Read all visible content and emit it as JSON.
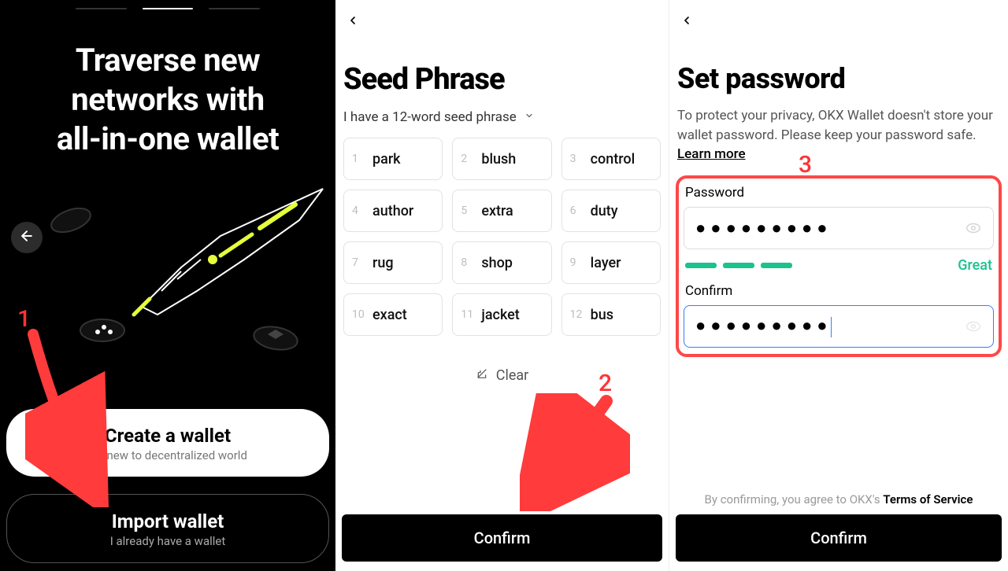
{
  "panel1": {
    "title": "Traverse new\nnetworks with\nall-in-one wallet",
    "page_index": 1,
    "page_count": 3,
    "create": {
      "title": "Create a wallet",
      "subtitle": "I'm new to decentralized world"
    },
    "import": {
      "title": "Import wallet",
      "subtitle": "I already have a wallet"
    }
  },
  "panel2": {
    "title": "Seed Phrase",
    "selector": "I have a 12-word seed phrase",
    "words": [
      "park",
      "blush",
      "control",
      "author",
      "extra",
      "duty",
      "rug",
      "shop",
      "layer",
      "exact",
      "jacket",
      "bus"
    ],
    "clear": "Clear",
    "confirm": "Confirm"
  },
  "panel3": {
    "title": "Set password",
    "desc_a": "To protect your privacy, OKX Wallet doesn't store your wallet password. Please keep your password safe. ",
    "learn": "Learn more",
    "password_label": "Password",
    "confirm_label": "Confirm",
    "strength_label": "Great",
    "strength_segments": 3,
    "password_dots": "●●●●●●●●●",
    "confirm_dots": "●●●●●●●●●",
    "terms_prefix": "By confirming, you agree to OKX's ",
    "terms_link": "Terms of Service",
    "confirm_btn": "Confirm"
  },
  "annotations": {
    "n1": "1",
    "n2": "2",
    "n3": "3"
  }
}
